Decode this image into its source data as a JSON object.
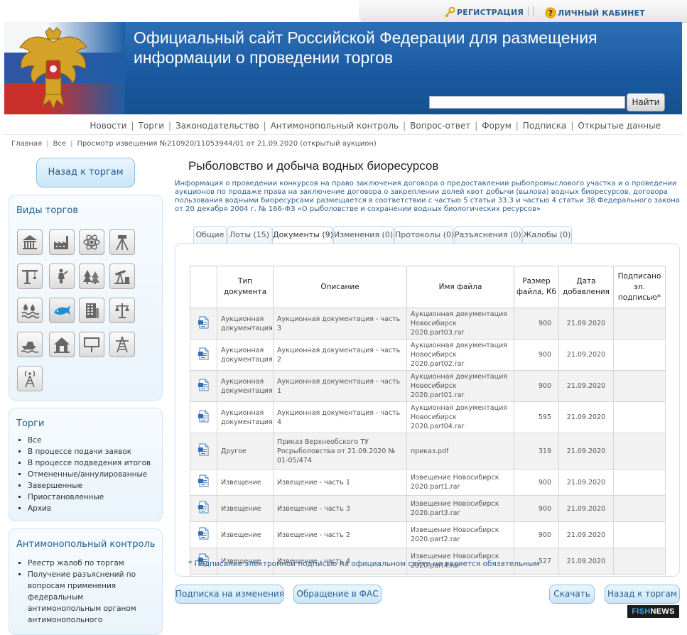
{
  "top": {
    "registration": "РЕГИСТРАЦИЯ",
    "cabinet": "ЛИЧНЫЙ КАБИНЕТ"
  },
  "header": {
    "title_line1": "Официальный сайт Российской Федерации для размещения",
    "title_line2": "информации о проведении торгов",
    "search_placeholder": "",
    "search_button": "Найти"
  },
  "nav": [
    "Новости",
    "Торги",
    "Законодательство",
    "Антимонопольный контроль",
    "Вопрос-ответ",
    "Форум",
    "Подписка",
    "Открытые данные"
  ],
  "breadcrumb": [
    "Главная",
    "Все",
    "Просмотр извещения №210920/11053944/01 от 21.09.2020 (открытый аукцион)"
  ],
  "sidebar": {
    "back_button": "Назад к торгам",
    "types_title": "Виды торгов",
    "type_icons": [
      "government-building-icon",
      "factory-icon",
      "atom-icon",
      "surveying-tripod-icon",
      "crane-icon",
      "monument-icon",
      "forest-icon",
      "oil-pump-icon",
      "water-icon",
      "fish-icon",
      "apartment-building-icon",
      "justice-scales-icon",
      "boat-icon",
      "house-icon",
      "billboard-icon",
      "power-tower-icon",
      "radio-tower-icon"
    ],
    "torgi_title": "Торги",
    "torgi_items": [
      "Все",
      "В процессе подачи заявок",
      "В процессе подведения итогов",
      "Отмененные/аннулированные",
      "Завершенные",
      "Приостановленные",
      "Архив"
    ],
    "anti_title": "Антимонопольный контроль",
    "anti_items": [
      "Реестр жалоб по торгам",
      "Получение разъяснений по вопросам применения федеральным антимонопольным органом антимонопольного"
    ]
  },
  "main": {
    "title": "Рыболовство и добыча водных биоресурсов",
    "description": "Информация о проведении конкурсов на право заключения договора о предоставлении рыбопромыслового участка и о проведении аукционов по продаже права на заключение договора о закреплении долей квот добычи (вылова) водных биоресурсов, договора пользования водными биоресурсами размещается в соответствии с частью 5 статьи 33.3 и частью 4 статьи 38 Федерального закона от 20 декабря 2004 г. № 166-ФЗ «О рыболовстве и сохранении водных биологических ресурсов»",
    "tabs": [
      "Общие",
      "Лоты (15)",
      "Документы (9)",
      "Изменения (0)",
      "Протоколы (0)",
      "Разъяснения (0)",
      "Жалобы (0)"
    ],
    "active_tab": "Документы (9)",
    "table": {
      "headers": [
        "",
        "Тип документа",
        "Описание",
        "Имя файла",
        "Размер файла, Кб",
        "Дата добавления",
        "Подписано эл. подписью*"
      ],
      "rows": [
        [
          "Аукционная документация",
          "Аукционная документация - часть 3",
          "Аукционная документация Новосибирск 2020.part03.rar",
          "900",
          "21.09.2020",
          ""
        ],
        [
          "Аукционная документация",
          "Аукционная документация - часть 2",
          "Аукционная документация Новосибирск 2020.part02.rar",
          "900",
          "21.09.2020",
          ""
        ],
        [
          "Аукционная документация",
          "Аукционная документация - часть 1",
          "Аукционная документация Новосибирск 2020.part01.rar",
          "900",
          "21.09.2020",
          ""
        ],
        [
          "Аукционная документация",
          "Аукционная документация - часть 4",
          "Аукционная документация Новосибирск 2020.part04.rar",
          "595",
          "21.09.2020",
          ""
        ],
        [
          "Другое",
          "Приказ Верхнеобского ТУ Росрыболовства от 21.09.2020 № 01-05/474",
          "приказ.pdf",
          "319",
          "21.09.2020",
          ""
        ],
        [
          "Извещение",
          "Извещение - часть 1",
          "Извещение Новосибирск 2020.part1.rar",
          "900",
          "21.09.2020",
          ""
        ],
        [
          "Извещение",
          "Извещение - часть 3",
          "Извещение Новосибирск 2020.part3.rar",
          "900",
          "21.09.2020",
          ""
        ],
        [
          "Извещение",
          "Извещение - часть 2",
          "Извещение Новосибирск 2020.part2.rar",
          "900",
          "21.09.2020",
          ""
        ],
        [
          "Извещение",
          "Извещение - часть 4",
          "Извещение Новосибирск 2020.part4.rar",
          "527",
          "21.09.2020",
          ""
        ]
      ]
    },
    "note": "* Подписание электронной подписью на официальном сайте не является обязательным",
    "buttons": {
      "subscribe": "Подписка на изменения",
      "fas": "Обращение в ФАС",
      "download": "Скачать",
      "back": "Назад к торгам"
    }
  },
  "watermark": {
    "part1": "FISH",
    "part2": "NEWS"
  },
  "colors": {
    "link": "#2a5f93",
    "header_blue": "#1b5aa0",
    "panel_border": "#cfe5f2"
  }
}
